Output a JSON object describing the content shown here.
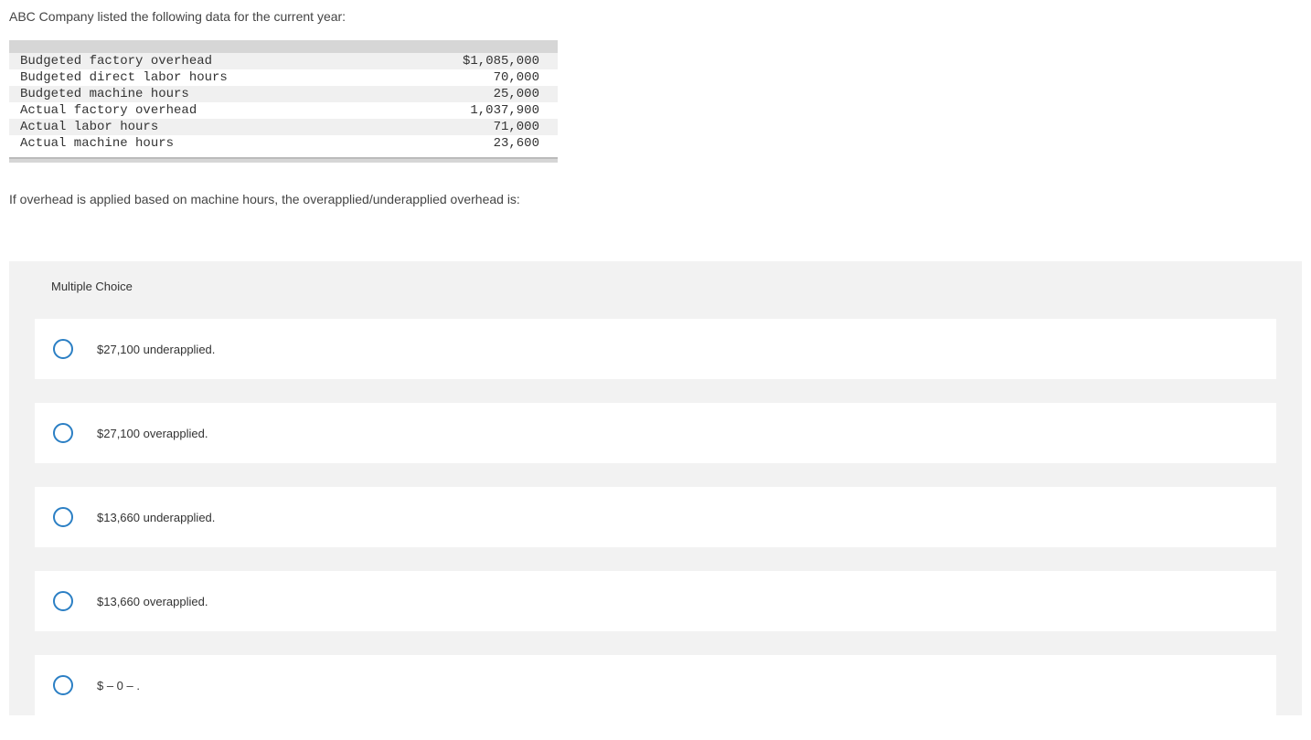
{
  "intro": "ABC Company listed the following data for the current year:",
  "table": {
    "rows": [
      {
        "label": "Budgeted factory overhead",
        "value": "$1,085,000"
      },
      {
        "label": "Budgeted direct labor hours",
        "value": "70,000"
      },
      {
        "label": "Budgeted machine hours",
        "value": "25,000"
      },
      {
        "label": "Actual factory overhead",
        "value": "1,037,900"
      },
      {
        "label": "Actual labor hours",
        "value": "71,000"
      },
      {
        "label": "Actual machine hours",
        "value": "23,600"
      }
    ]
  },
  "question": "If overhead is applied based on machine hours, the overapplied/underapplied overhead is:",
  "mc_title": "Multiple Choice",
  "choices": [
    "$27,100 underapplied.",
    "$27,100 overapplied.",
    "$13,660 underapplied.",
    "$13,660 overapplied.",
    "$ – 0 – ."
  ]
}
